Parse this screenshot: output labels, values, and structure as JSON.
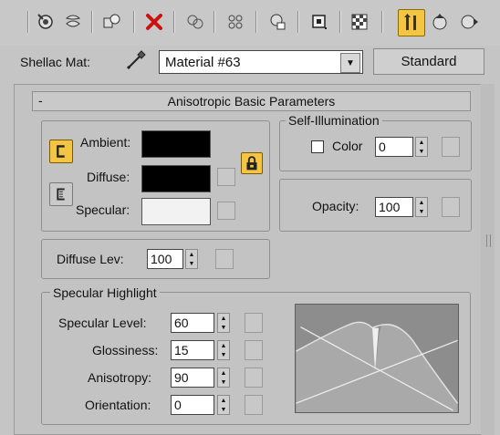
{
  "toolbar": {
    "icons": [
      "pick-material-icon",
      "put-to-scene-icon",
      "assign-material-icon",
      "delete-icon",
      "make-unique-icon",
      "put-to-library-icon",
      "material-id-icon",
      "show-map-icon",
      "background-icon",
      "show-end-result-icon",
      "go-to-parent-icon",
      "go-forward-sibling-icon"
    ]
  },
  "material": {
    "label": "Shellac Mat:",
    "name": "Material #63",
    "type_button": "Standard"
  },
  "rollout": {
    "collapse": "-",
    "title": "Anisotropic Basic Parameters"
  },
  "basic": {
    "ambient_label": "Ambient:",
    "diffuse_label": "Diffuse:",
    "specular_label": "Specular:",
    "ambient_color": "#000000",
    "diffuse_color": "#000000",
    "specular_color": "#f2f2f2"
  },
  "self_illum": {
    "title": "Self-Illumination",
    "color_label": "Color",
    "value": "0"
  },
  "opacity": {
    "label": "Opacity:",
    "value": "100"
  },
  "diffuse_level": {
    "label": "Diffuse Lev:",
    "value": "100"
  },
  "specular_highlight": {
    "title": "Specular Highlight",
    "rows": [
      {
        "label": "Specular Level:",
        "value": "60"
      },
      {
        "label": "Glossiness:",
        "value": "15"
      },
      {
        "label": "Anisotropy:",
        "value": "90"
      },
      {
        "label": "Orientation:",
        "value": "0"
      }
    ]
  },
  "colors": {
    "active_toggle": "#f4c542",
    "panel_bg": "#c3c3c3"
  }
}
